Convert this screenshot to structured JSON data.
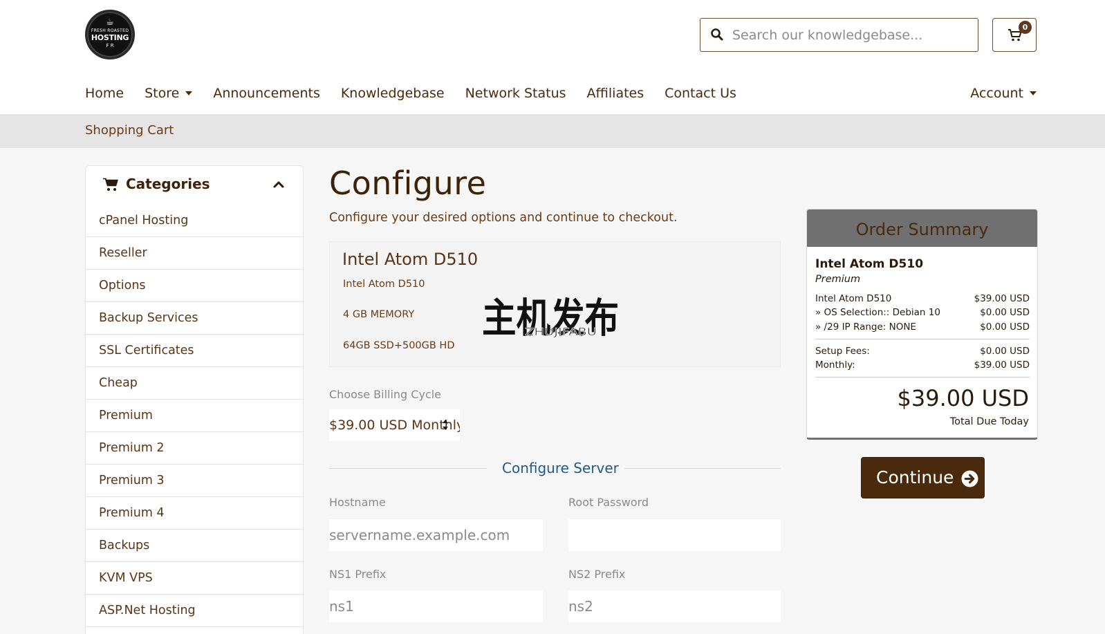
{
  "logo": {
    "line1": "FRESH ROASTED",
    "line2": "HOSTING",
    "line3": "F R"
  },
  "search": {
    "placeholder": "Search our knowledgebase..."
  },
  "cart": {
    "count": "0"
  },
  "nav": {
    "items": [
      {
        "label": "Home",
        "dropdown": false
      },
      {
        "label": "Store",
        "dropdown": true
      },
      {
        "label": "Announcements",
        "dropdown": false
      },
      {
        "label": "Knowledgebase",
        "dropdown": false
      },
      {
        "label": "Network Status",
        "dropdown": false
      },
      {
        "label": "Affiliates",
        "dropdown": false
      },
      {
        "label": "Contact Us",
        "dropdown": false
      }
    ],
    "account": "Account"
  },
  "breadcrumb": {
    "label": "Shopping Cart"
  },
  "sidebar": {
    "title": "Categories",
    "items": [
      "cPanel Hosting",
      "Reseller",
      "Options",
      "Backup Services",
      "SSL Certificates",
      "Cheap",
      "Premium",
      "Premium 2",
      "Premium 3",
      "Premium 4",
      "Backups",
      "KVM VPS",
      "ASP.Net Hosting"
    ]
  },
  "main": {
    "title": "Configure",
    "subtitle": "Configure your desired options and continue to checkout.",
    "product": {
      "name": "Intel Atom D510",
      "line1": "Intel Atom D510",
      "line2": "4 GB MEMORY",
      "line3": "64GB SSD+500GB HD",
      "brand_cn": "主机发布",
      "brand_en": "ZHUJIFABU"
    },
    "billing": {
      "label": "Choose Billing Cycle",
      "value": "$39.00 USD Monthly"
    },
    "configure_title": "Configure Server",
    "fields": {
      "hostname_label": "Hostname",
      "hostname_placeholder": "servername.example.com",
      "rootpw_label": "Root Password",
      "rootpw_value": "",
      "ns1_label": "NS1 Prefix",
      "ns1_placeholder": "ns1",
      "ns2_label": "NS2 Prefix",
      "ns2_placeholder": "ns2"
    }
  },
  "summary": {
    "title": "Order Summary",
    "product": "Intel Atom D510",
    "group": "Premium",
    "lines": [
      {
        "label": "Intel Atom D510",
        "value": "$39.00 USD"
      },
      {
        "label": " » OS Selection:: Debian 10",
        "value": "$0.00 USD"
      },
      {
        "label": " » /29 IP Range: NONE",
        "value": "$0.00 USD"
      }
    ],
    "setup_label": "Setup Fees:",
    "setup_value": "$0.00 USD",
    "monthly_label": "Monthly:",
    "monthly_value": "$39.00 USD",
    "total": "$39.00 USD",
    "total_label": "Total Due Today"
  },
  "continue_label": "Continue",
  "colors": {
    "brand_dark": "#4a2a0d",
    "link": "#1e5a8a",
    "summary_header": "#707070"
  }
}
